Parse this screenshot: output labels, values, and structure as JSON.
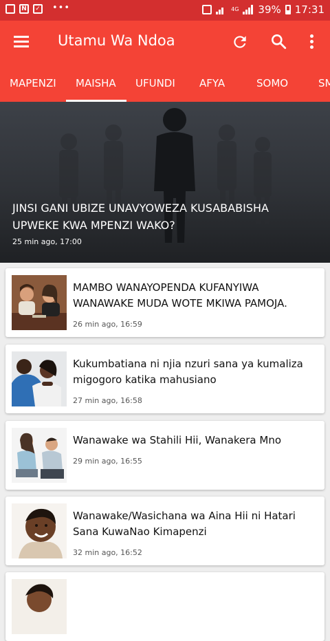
{
  "status_bar": {
    "network": "4G",
    "battery": "39%",
    "time": "17:31"
  },
  "app_bar": {
    "title": "Utamu Wa Ndoa"
  },
  "tabs": [
    "Mapenzi",
    "Maisha",
    "Ufundi",
    "Afya",
    "Somo",
    "Sm"
  ],
  "hero": {
    "title": "Jinsi gani ubize unavyoweza kusababisha upweke kwa mpenzi wako?",
    "time": "25 min ago, 17:00"
  },
  "articles": [
    {
      "title": "MAMBO WANAYOPENDA KUFANYIWA WANAWAKE MUDA WOTE MKIWA PAMOJA.",
      "time": "26 min ago, 16:59"
    },
    {
      "title": "Kukumbatiana ni njia nzuri sana ya kumaliza migogoro katika mahusiano",
      "time": "27 min ago, 16:58"
    },
    {
      "title": "Wanawake wa Stahili Hii, Wanakera Mno",
      "time": "29 min ago, 16:55"
    },
    {
      "title": "Wanawake/Wasichana wa Aina Hii ni Hatari Sana KuwaNao Kimapenzi",
      "time": "32 min ago, 16:52"
    }
  ],
  "colors": {
    "status_bar": "#d32f2f",
    "app_bar": "#f44336",
    "background": "#eeeeee"
  }
}
